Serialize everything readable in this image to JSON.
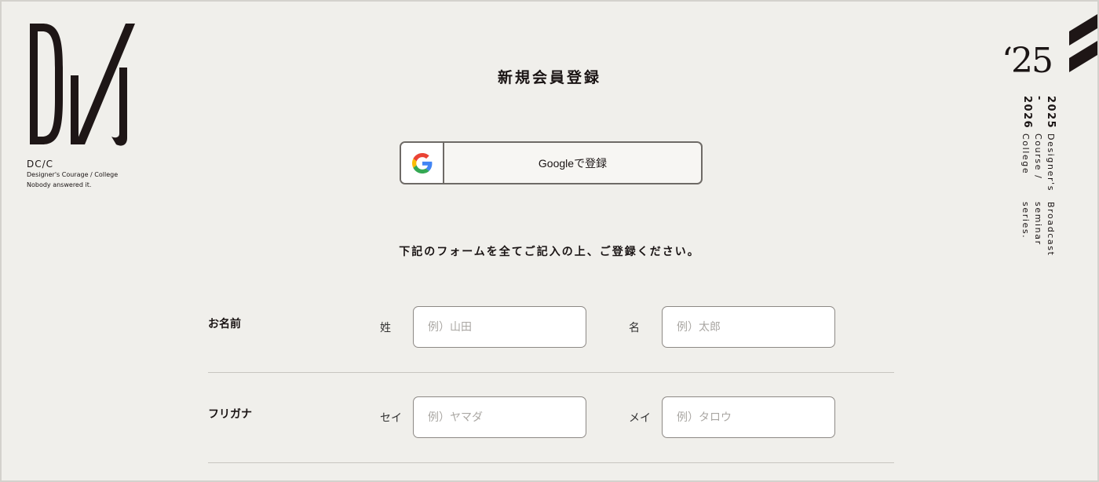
{
  "logo": {
    "name": "DC/C",
    "line1": "Designer's Courage / College",
    "line2": "Nobody answered it."
  },
  "badge": {
    "year": "‘25",
    "range": "2025 - 2026",
    "line1": "Designer's Course / College",
    "line2": "Broadcast seminar series."
  },
  "page": {
    "title": "新規会員登録",
    "intro": "下記のフォームを全てご記入の上、ご登録ください。"
  },
  "google": {
    "label": "Googleで登録",
    "icon": "google-g-icon"
  },
  "form": {
    "rows": [
      {
        "label": "お名前",
        "fields": [
          {
            "label": "姓",
            "placeholder": "例）山田",
            "value": ""
          },
          {
            "label": "名",
            "placeholder": "例）太郎",
            "value": ""
          }
        ]
      },
      {
        "label": "フリガナ",
        "fields": [
          {
            "label": "セイ",
            "placeholder": "例）ヤマダ",
            "value": ""
          },
          {
            "label": "メイ",
            "placeholder": "例）タロウ",
            "value": ""
          }
        ]
      }
    ]
  },
  "colors": {
    "background": "#f0efeb",
    "text": "#1a1414",
    "border": "#8d8985"
  }
}
